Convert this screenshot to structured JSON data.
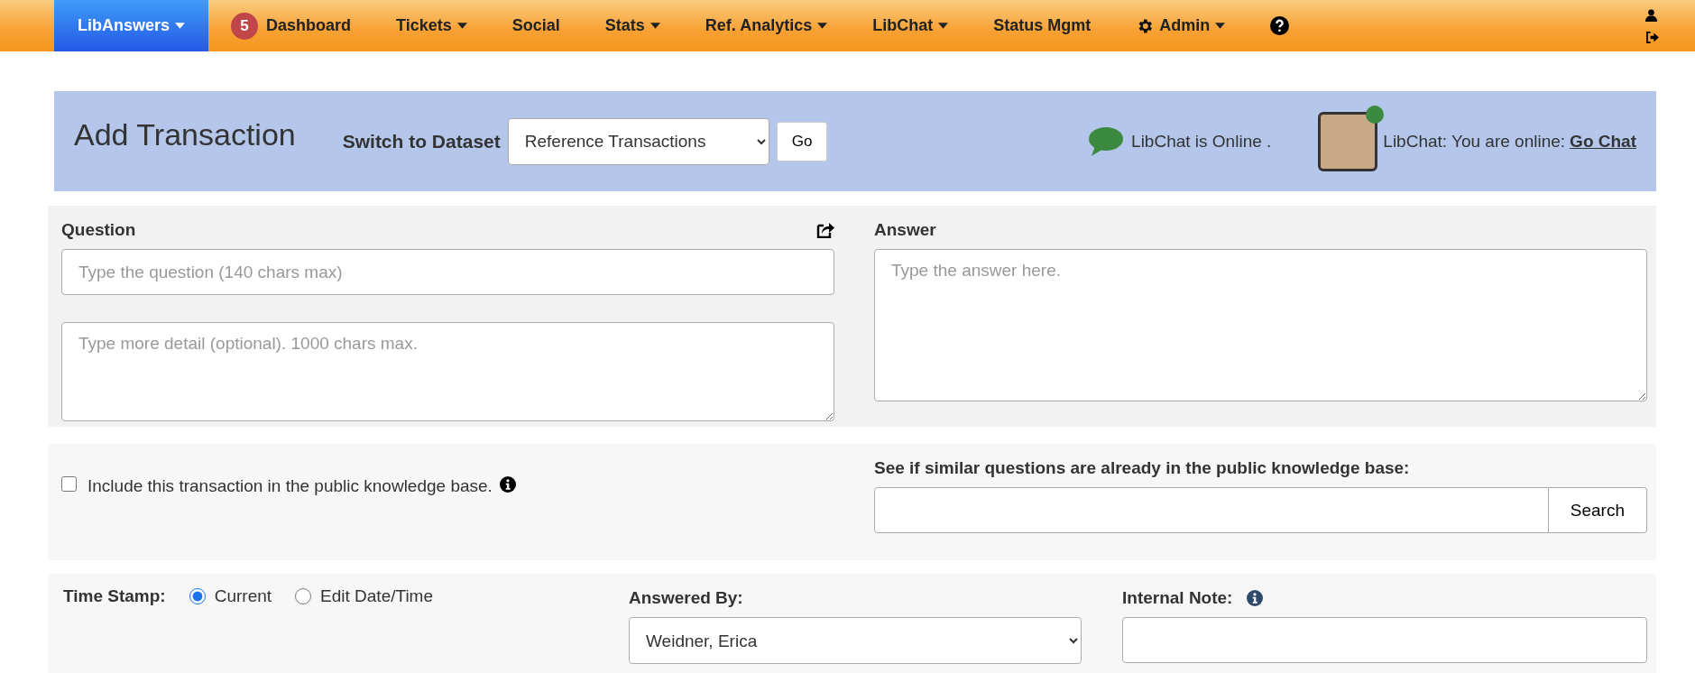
{
  "navbar": {
    "brand": {
      "label": "LibAnswers",
      "dropdown": true,
      "selected": true
    },
    "items": [
      {
        "kind": "link",
        "label": "Dashboard",
        "badge": "5",
        "dropdown": false,
        "selected": false
      },
      {
        "kind": "link",
        "label": "Tickets",
        "dropdown": true,
        "selected": false
      },
      {
        "kind": "link",
        "label": "Social",
        "dropdown": false,
        "selected": false
      },
      {
        "kind": "link",
        "label": "Stats",
        "dropdown": true,
        "selected": false
      },
      {
        "kind": "link",
        "label": "Ref. Analytics",
        "dropdown": true,
        "selected": false
      },
      {
        "kind": "link",
        "label": "LibChat",
        "dropdown": true,
        "selected": false
      },
      {
        "kind": "link",
        "label": "Status Mgmt",
        "dropdown": false,
        "selected": false
      },
      {
        "kind": "settings",
        "label": "Admin",
        "dropdown": true,
        "selected": false
      },
      {
        "kind": "help",
        "selected": false
      }
    ]
  },
  "header": {
    "title": "Add Transaction",
    "dataset_label": "Switch to Dataset",
    "dataset_value": "Reference Transactions",
    "go_button": "Go",
    "chat_status": "LibChat is Online .",
    "user_status": "LibChat: You are online:",
    "go_chat_link": "Go Chat",
    "online": true
  },
  "question_panel": {
    "question_label": "Question",
    "question_placeholder": "Type the question (140 chars max)",
    "detail_placeholder": "Type more detail (optional). 1000 chars max.",
    "answer_label": "Answer",
    "answer_placeholder": "Type the answer here."
  },
  "knowledge_panel": {
    "include_label": "Include this transaction in the public knowledge base.",
    "include_checked": false,
    "search_label": "See if similar questions are already in the public knowledge base:",
    "search_button": "Search"
  },
  "details_panel": {
    "time_stamp_label": "Time Stamp:",
    "time_options": [
      {
        "label": "Current",
        "selected": true
      },
      {
        "label": "Edit Date/Time",
        "selected": false
      }
    ],
    "answered_by_label": "Answered By:",
    "answered_by_value": "Weidner, Erica",
    "internal_note_label": "Internal Note:"
  }
}
